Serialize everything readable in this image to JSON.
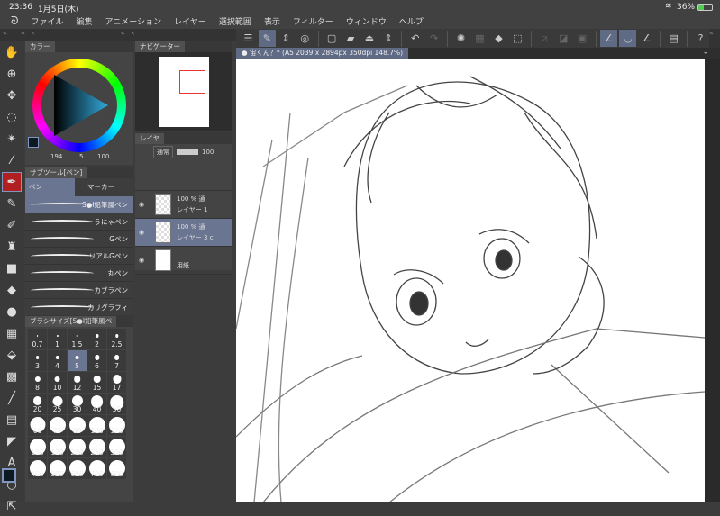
{
  "status": {
    "time": "23:36",
    "date": "1月5日(木)",
    "battery": "36%",
    "wifi_icon": "wifi-icon",
    "battery_icon": "battery-charging-icon"
  },
  "menu": [
    "ファイル",
    "編集",
    "アニメーション",
    "レイヤー",
    "選択範囲",
    "表示",
    "フィルター",
    "ウィンドウ",
    "ヘルプ"
  ],
  "document_tab": "● 宙くん？* (A5 2039 x 2894px 350dpi 148.7%)",
  "color_panel": {
    "tab": "カラー",
    "h": "194",
    "s": "5",
    "v": "100",
    "main_color": "#0e1a22",
    "sub_color": "#ffffff"
  },
  "navigator": {
    "tab": "ナビゲーター"
  },
  "layer_panel": {
    "tab": "レイヤ",
    "blend": "通常",
    "opacity": "100",
    "layers": [
      {
        "opacity": "100 %",
        "mode": "通",
        "name": "レイヤー 1"
      },
      {
        "opacity": "100 %",
        "mode": "通",
        "name": "レイヤー 3 c"
      },
      {
        "opacity": "",
        "mode": "",
        "name": "用紙"
      }
    ]
  },
  "subtool": {
    "tab": "サブツール[ペン]",
    "groups": [
      "ペン",
      "マーカー"
    ],
    "items": [
      "S●I鉛筆風ペン",
      "うにゃペン",
      "Gペン",
      "リアルGペン",
      "丸ペン",
      "カブラペン",
      "カリグラフィ"
    ]
  },
  "brush_size": {
    "tab": "ブラシサイズ[S●I鉛筆風ペ",
    "sizes": [
      "0.7",
      "1",
      "1.5",
      "2",
      "2.5",
      "3",
      "4",
      "5",
      "6",
      "7",
      "8",
      "10",
      "12",
      "15",
      "17",
      "20",
      "25",
      "30",
      "40",
      "50",
      "60",
      "70",
      "80",
      "100",
      "120",
      "150",
      "170",
      "200",
      "250",
      "300",
      "400",
      "500",
      "600",
      "700",
      "800"
    ],
    "selected": "5"
  },
  "colors": {
    "accent": "#5f6a85",
    "selected_tool": "#b02020"
  }
}
